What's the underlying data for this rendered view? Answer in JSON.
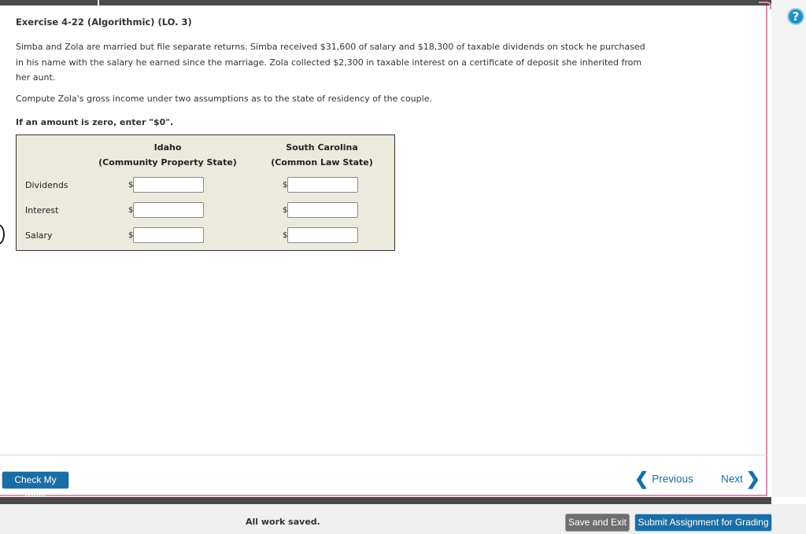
{
  "exercise": {
    "title": "Exercise 4-22 (Algorithmic) (LO. 3)",
    "paragraph": "Simba and Zola are married but file separate returns. Simba received $31,600 of salary and $18,300 of taxable dividends on stock he purchased in his name with the salary he earned since the marriage. Zola collected $2,300 in taxable interest on a certificate of deposit she inherited from her aunt.",
    "compute_prompt": "Compute Zola's gross income under two assumptions as to the state of residency of the couple.",
    "zero_note": "If an amount is zero, enter \"$0\"."
  },
  "table": {
    "col1_line1": "Idaho",
    "col1_line2": "(Community Property State)",
    "col2_line1": "South Carolina",
    "col2_line2": "(Common Law State)",
    "currency_symbol": "$",
    "rows": [
      {
        "label": "Dividends",
        "idaho_value": "",
        "sc_value": ""
      },
      {
        "label": "Interest",
        "idaho_value": "",
        "sc_value": ""
      },
      {
        "label": "Salary",
        "idaho_value": "",
        "sc_value": ""
      }
    ]
  },
  "actions": {
    "check_my_work": "Check My Work",
    "previous": "Previous",
    "next": "Next",
    "save_and_exit": "Save and Exit",
    "submit": "Submit Assignment for Grading",
    "status": "All work saved.",
    "help_symbol": "?"
  },
  "icons": {
    "previous": "chevron-left-icon",
    "next": "chevron-right-icon",
    "help": "help-circle-icon"
  },
  "colors": {
    "accent": "#1b6ea5",
    "panel_border": "#e58bb2",
    "table_bg": "#eceadc",
    "save_button": "#6e6e6e"
  }
}
